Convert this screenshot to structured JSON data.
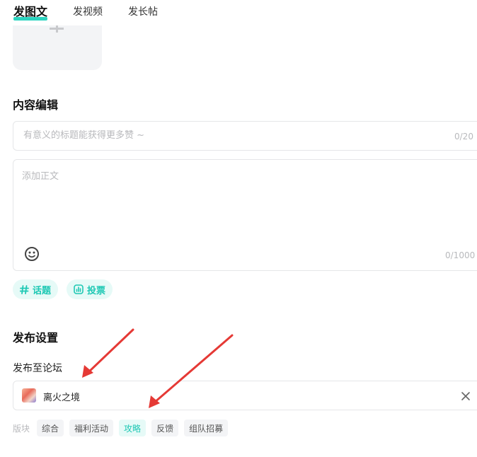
{
  "tabs": [
    {
      "label": "发图文",
      "active": true
    },
    {
      "label": "发视频",
      "active": false
    },
    {
      "label": "发长帖",
      "active": false
    }
  ],
  "upload": {
    "icon": "plus-icon"
  },
  "content_section": {
    "title": "内容编辑",
    "title_input": {
      "placeholder": "有意义的标题能获得更多赞 ~",
      "value": "",
      "counter": "0/20"
    },
    "body_input": {
      "placeholder": "添加正文",
      "counter": "0/1000",
      "emoji_icon": "emoji-icon"
    },
    "tools": [
      {
        "label": "话题",
        "icon": "hash-icon"
      },
      {
        "label": "投票",
        "icon": "vote-icon"
      }
    ]
  },
  "publish_section": {
    "title": "发布设置",
    "forum_label": "发布至论坛",
    "forum": {
      "name": "离火之境",
      "icon": "forum-avatar"
    },
    "block_label": "版块",
    "blocks": [
      {
        "label": "综合",
        "selected": false
      },
      {
        "label": "福利活动",
        "selected": false
      },
      {
        "label": "攻略",
        "selected": true
      },
      {
        "label": "反馈",
        "selected": false
      },
      {
        "label": "组队招募",
        "selected": false
      }
    ]
  },
  "colors": {
    "accent": "#2bd4c0",
    "accent_text": "#1ec8b4",
    "accent_bg": "#e6faf7",
    "arrow": "#e53935"
  }
}
